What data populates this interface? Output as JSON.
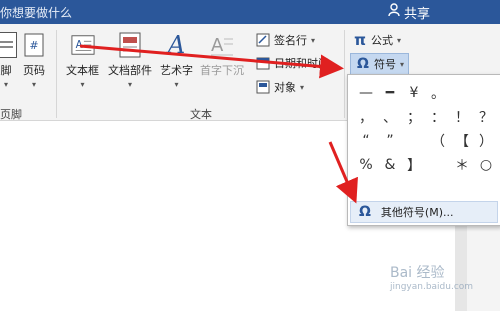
{
  "titlebar": {
    "tell_me_text": "你想要做什么",
    "share_label": "共享"
  },
  "ribbon": {
    "header_footer": {
      "footer_label": "脚",
      "page_number_label": "页码",
      "group_label": "页脚"
    },
    "text_group": {
      "group_label": "文本",
      "text_box_label": "文本框",
      "quick_parts_label": "文档部件",
      "wordart_label": "艺术字",
      "drop_cap_label": "首字下沉",
      "signature_line_label": "签名行",
      "date_time_label": "日期和时间",
      "object_label": "对象"
    },
    "symbols_group": {
      "equation_label": "公式",
      "symbol_label": "符号"
    }
  },
  "symbol_dropdown": {
    "symbols": [
      "—",
      "━",
      "¥",
      "。",
      "，",
      "、",
      "；",
      "：",
      "！",
      "？",
      "“",
      "”",
      "（",
      "【",
      "）",
      "%",
      "&",
      "】",
      "＊",
      "○"
    ],
    "more_symbols_label": "其他符号(M)..."
  },
  "watermark": {
    "text": "Bai 经验",
    "subtext": "jingyan.baidu.com"
  }
}
